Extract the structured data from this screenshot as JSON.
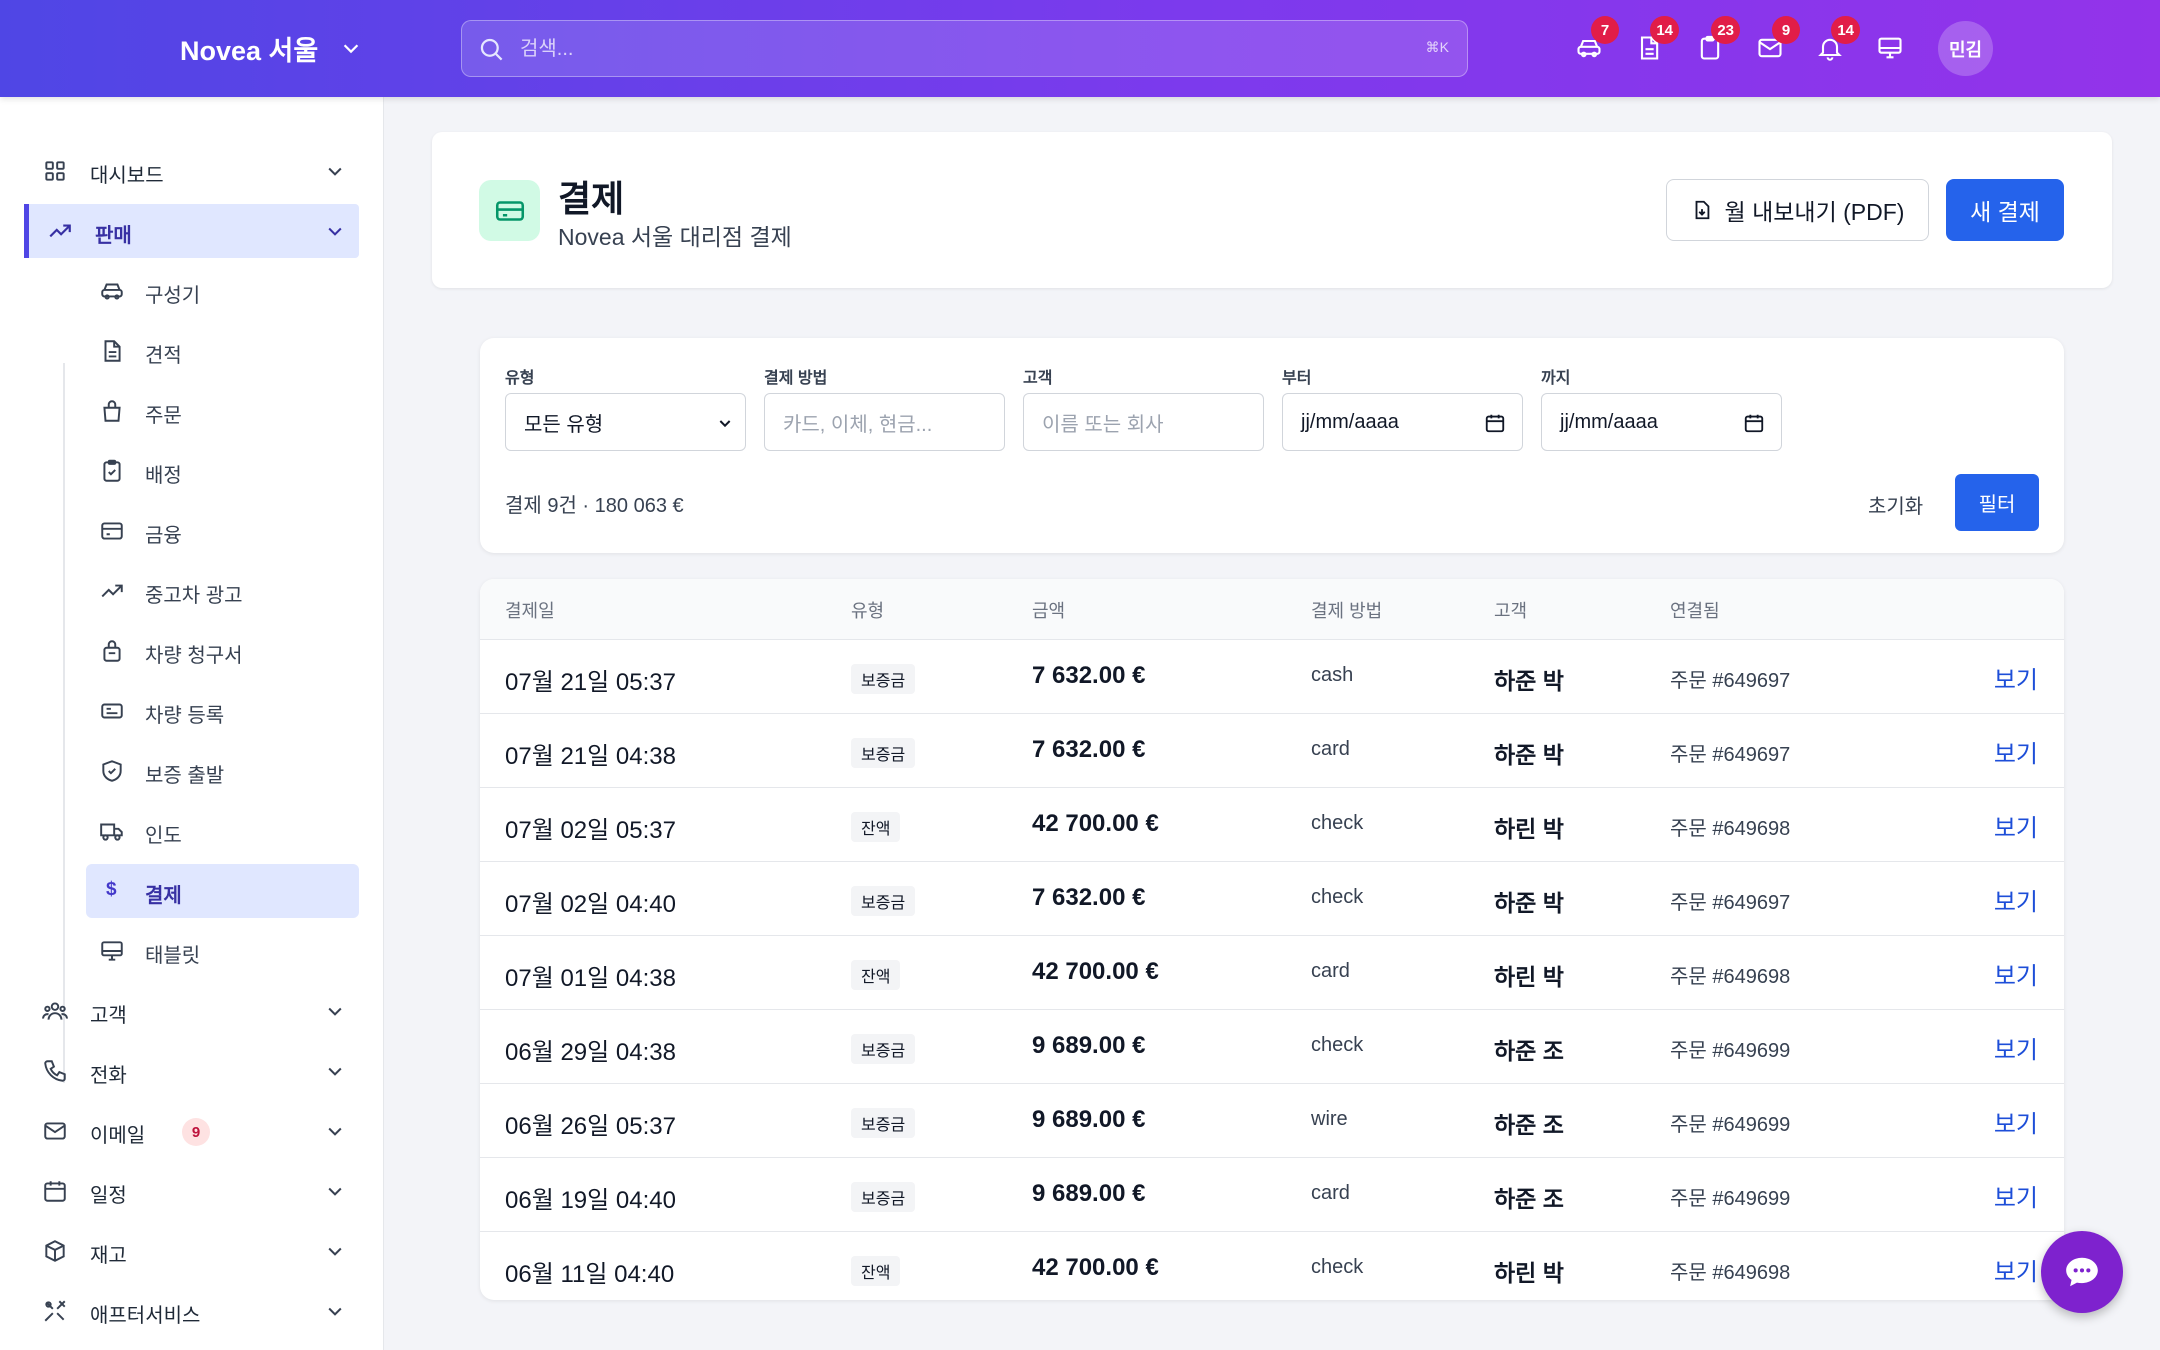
{
  "topbar": {
    "brand": "Novea 서울",
    "search_placeholder": "검색...",
    "shortcut": "⌘K",
    "badges": [
      "7",
      "14",
      "23",
      "9",
      "14"
    ],
    "avatar": "민김"
  },
  "sidebar": {
    "items": [
      {
        "label": "대시보드",
        "icon": "grid-icon"
      },
      {
        "label": "판매",
        "icon": "trending-icon"
      }
    ],
    "sub_items": [
      {
        "label": "구성기",
        "icon": "car-icon"
      },
      {
        "label": "견적",
        "icon": "document-icon"
      },
      {
        "label": "주문",
        "icon": "bag-icon"
      },
      {
        "label": "배정",
        "icon": "clipboard-check-icon"
      },
      {
        "label": "금융",
        "icon": "credit-card-icon"
      },
      {
        "label": "중고차 광고",
        "icon": "trending-icon"
      },
      {
        "label": "차량 청구서",
        "icon": "shopping-bag-icon"
      },
      {
        "label": "차량 등록",
        "icon": "id-card-icon"
      },
      {
        "label": "보증 출발",
        "icon": "shield-check-icon"
      },
      {
        "label": "인도",
        "icon": "truck-icon"
      },
      {
        "label": "결제",
        "icon": "dollar-icon"
      },
      {
        "label": "태블릿",
        "icon": "monitor-icon"
      }
    ],
    "bottom_items": [
      {
        "label": "고객",
        "icon": "users-icon"
      },
      {
        "label": "전화",
        "icon": "phone-icon"
      },
      {
        "label": "이메일",
        "icon": "mail-icon",
        "badge": "9"
      },
      {
        "label": "일정",
        "icon": "calendar-icon"
      },
      {
        "label": "재고",
        "icon": "box-icon"
      },
      {
        "label": "애프터서비스",
        "icon": "tools-icon"
      }
    ]
  },
  "header": {
    "title": "결제",
    "subtitle": "Novea 서울 대리점 결제",
    "export_label": "월 내보내기 (PDF)",
    "new_label": "새 결제"
  },
  "filters": {
    "type_label": "유형",
    "type_value": "모든 유형",
    "method_label": "결제 방법",
    "method_placeholder": "카드, 이체, 현금...",
    "customer_label": "고객",
    "customer_placeholder": "이름 또는 회사",
    "from_label": "부터",
    "from_value": "jj/mm/aaaa",
    "to_label": "까지",
    "to_value": "jj/mm/aaaa",
    "summary": "결제 9건 · 180 063 €",
    "reset_label": "초기화",
    "filter_label": "필터"
  },
  "table": {
    "headers": [
      "결제일",
      "유형",
      "금액",
      "결제 방법",
      "고객",
      "연결됨"
    ],
    "view_label": "보기",
    "rows": [
      {
        "date": "07월 21일 05:37",
        "type": "보증금",
        "amount": "7 632.00 €",
        "method": "cash",
        "customer": "하준 박",
        "linked": "주문 #649697"
      },
      {
        "date": "07월 21일 04:38",
        "type": "보증금",
        "amount": "7 632.00 €",
        "method": "card",
        "customer": "하준 박",
        "linked": "주문 #649697"
      },
      {
        "date": "07월 02일 05:37",
        "type": "잔액",
        "amount": "42 700.00 €",
        "method": "check",
        "customer": "하린 박",
        "linked": "주문 #649698"
      },
      {
        "date": "07월 02일 04:40",
        "type": "보증금",
        "amount": "7 632.00 €",
        "method": "check",
        "customer": "하준 박",
        "linked": "주문 #649697"
      },
      {
        "date": "07월 01일 04:38",
        "type": "잔액",
        "amount": "42 700.00 €",
        "method": "card",
        "customer": "하린 박",
        "linked": "주문 #649698"
      },
      {
        "date": "06월 29일 04:38",
        "type": "보증금",
        "amount": "9 689.00 €",
        "method": "check",
        "customer": "하준 조",
        "linked": "주문 #649699"
      },
      {
        "date": "06월 26일 05:37",
        "type": "보증금",
        "amount": "9 689.00 €",
        "method": "wire",
        "customer": "하준 조",
        "linked": "주문 #649699"
      },
      {
        "date": "06월 19일 04:40",
        "type": "보증금",
        "amount": "9 689.00 €",
        "method": "card",
        "customer": "하준 조",
        "linked": "주문 #649699"
      },
      {
        "date": "06월 11일 04:40",
        "type": "잔액",
        "amount": "42 700.00 €",
        "method": "check",
        "customer": "하린 박",
        "linked": "주문 #649698"
      }
    ]
  },
  "colors": {
    "accent": "#2563eb",
    "brand_start": "#4f46e5",
    "brand_end": "#9333ea",
    "badge": "#e11d48"
  }
}
